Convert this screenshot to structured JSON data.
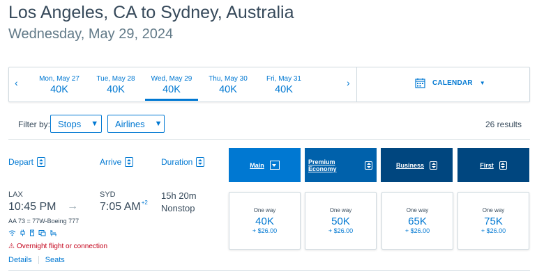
{
  "header": {
    "title": "Los Angeles, CA to Sydney, Australia",
    "subtitle": "Wednesday, May 29, 2024"
  },
  "date_bar": {
    "prev": "‹",
    "next": "›",
    "dates": [
      {
        "date": "Mon, May 27",
        "price": "40K"
      },
      {
        "date": "Tue, May 28",
        "price": "40K"
      },
      {
        "date": "Wed, May 29",
        "price": "40K"
      },
      {
        "date": "Thu, May 30",
        "price": "40K"
      },
      {
        "date": "Fri, May 31",
        "price": "40K"
      }
    ],
    "active_index": 2,
    "calendar_label": "CALENDAR",
    "calendar_caret": "▼"
  },
  "filters": {
    "label": "Filter by:",
    "stops": "Stops",
    "airlines": "Airlines",
    "caret": "▼",
    "results": "26 results"
  },
  "columns": {
    "depart": "Depart",
    "arrive": "Arrive",
    "duration": "Duration"
  },
  "cabins": [
    {
      "label": "Main",
      "color": "#0078d2"
    },
    {
      "label": "Premium Economy",
      "color": "#0061ab"
    },
    {
      "label": "Business",
      "color": "#00467f"
    },
    {
      "label": "First",
      "color": "#00467f"
    }
  ],
  "flight": {
    "depart_airport": "LAX",
    "depart_time": "10:45 PM",
    "arrow": "→",
    "arrive_airport": "SYD",
    "arrive_time": "7:05 AM",
    "day_offset": "+2",
    "duration": "15h 20m",
    "stops": "Nonstop",
    "flight_info": "AA 73 = 77W-Boeing 777",
    "amenity_icons": [
      "wifi-icon",
      "power-icon",
      "usb-icon",
      "entertainment-icon",
      "lie-flat-seat-icon"
    ],
    "warning_icon": "⚠",
    "warning": "Overnight flight or connection",
    "details_link": "Details",
    "seats_link": "Seats",
    "fares": [
      {
        "label": "One way",
        "points": "40K",
        "taxes": "+ $26.00"
      },
      {
        "label": "One way",
        "points": "50K",
        "taxes": "+ $26.00"
      },
      {
        "label": "One way",
        "points": "65K",
        "taxes": "+ $26.00"
      },
      {
        "label": "One way",
        "points": "75K",
        "taxes": "+ $26.00"
      }
    ]
  },
  "colors": {
    "accent": "#0078d2",
    "text": "#36495a",
    "warning": "#c30019"
  }
}
